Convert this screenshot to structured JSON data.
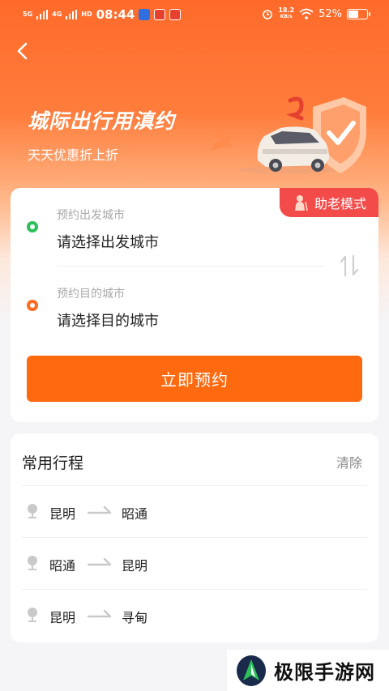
{
  "status_bar": {
    "net1": "5G",
    "net2": "4G",
    "hd": "HD",
    "time": "08:44",
    "speed_value": "18.2",
    "speed_unit": "KB/s",
    "battery": "52%"
  },
  "hero": {
    "title": "城际出行用滇约",
    "subtitle": "天天优惠折上折"
  },
  "booking": {
    "elder_mode_label": "助老模式",
    "origin_label": "预约出发城市",
    "origin_placeholder": "请选择出发城市",
    "destination_label": "预约目的城市",
    "destination_placeholder": "请选择目的城市",
    "book_button": "立即预约"
  },
  "frequent_trips": {
    "title": "常用行程",
    "clear_label": "清除",
    "trips": [
      {
        "from": "昆明",
        "to": "昭通"
      },
      {
        "from": "昭通",
        "to": "昆明"
      },
      {
        "from": "昆明",
        "to": "寻甸"
      }
    ]
  },
  "watermark": {
    "text": "极限手游网"
  },
  "colors": {
    "accent": "#ff6a10",
    "elder_badge": "#f34a4a",
    "origin_dot": "#2cbf5a",
    "destination_dot": "#ff6a22"
  }
}
